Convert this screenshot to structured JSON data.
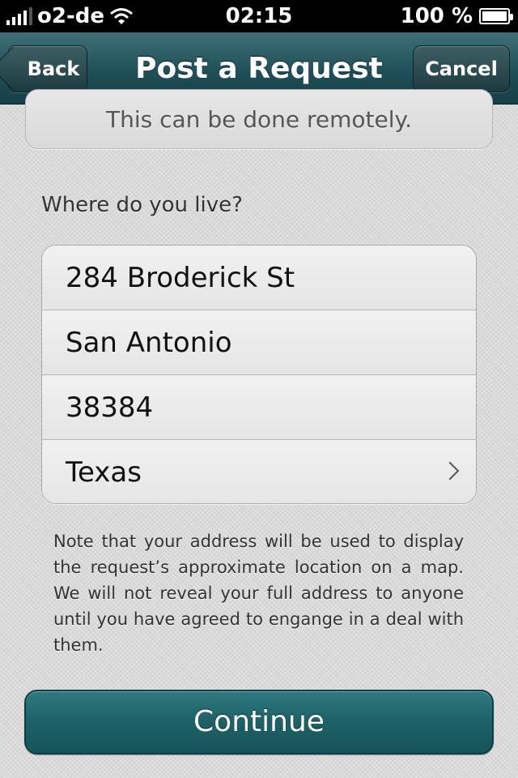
{
  "status_bar": {
    "carrier": "o2-de",
    "time": "02:15",
    "battery": "100 %"
  },
  "nav": {
    "back_label": "Back",
    "title": "Post a Request",
    "cancel_label": "Cancel"
  },
  "remote_card": {
    "text": "This can be done remotely."
  },
  "address_section": {
    "label": "Where do you live?",
    "fields": [
      {
        "value": "284 Broderick St"
      },
      {
        "value": "San Antonio"
      },
      {
        "value": "38384"
      },
      {
        "value": "Texas"
      }
    ]
  },
  "note": "Note that your address will be used to display the request’s approximate location on a map. We will not  reveal your full address to anyone until you have agreed to engange in a deal with them.",
  "continue_label": "Continue",
  "icons": [
    "signal-icon",
    "wifi-icon",
    "battery-icon",
    "back-arrow-icon",
    "chevron-right-icon"
  ]
}
